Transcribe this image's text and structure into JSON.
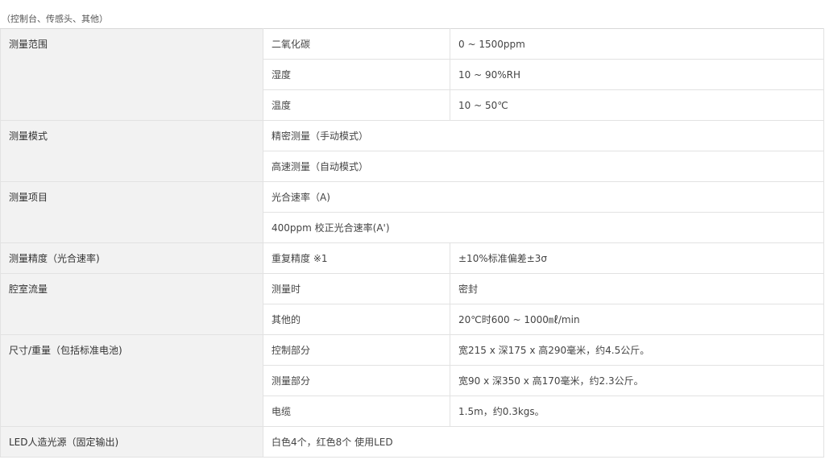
{
  "caption": "（控制台、传感头、其他）",
  "rows": {
    "range": {
      "label": "测量范围",
      "items": [
        {
          "name": "二氧化碳",
          "value": "0 ~ 1500ppm"
        },
        {
          "name": "湿度",
          "value": "10 ~ 90%RH"
        },
        {
          "name": "温度",
          "value": "10 ~ 50℃"
        }
      ]
    },
    "mode": {
      "label": "测量模式",
      "items": [
        "精密测量（手动模式）",
        "高速测量（自动模式）"
      ]
    },
    "items": {
      "label": "测量项目",
      "items": [
        "光合速率（A)",
        "400ppm 校正光合速率(A')"
      ]
    },
    "accuracy": {
      "label": "测量精度（光合速率)",
      "items": [
        {
          "name": "重复精度 ※1",
          "value": "±10%标准偏差±3σ"
        }
      ]
    },
    "flow": {
      "label": "腔室流量",
      "items": [
        {
          "name": "测量时",
          "value": "密封"
        },
        {
          "name": "其他的",
          "value": "20℃时600 ~ 1000㎖/min"
        }
      ]
    },
    "size": {
      "label": "尺寸/重量（包括标准电池)",
      "items": [
        {
          "name": "控制部分",
          "value": "宽215 x 深175 x 高290毫米，约4.5公斤。"
        },
        {
          "name": "测量部分",
          "value": "宽90 x 深350 x 高170毫米，约2.3公斤。"
        },
        {
          "name": "电缆",
          "value": "1.5m，约0.3kgs。"
        }
      ]
    },
    "led": {
      "label": "LED人造光源（固定输出)",
      "value": "白色4个，红色8个 使用LED"
    }
  }
}
